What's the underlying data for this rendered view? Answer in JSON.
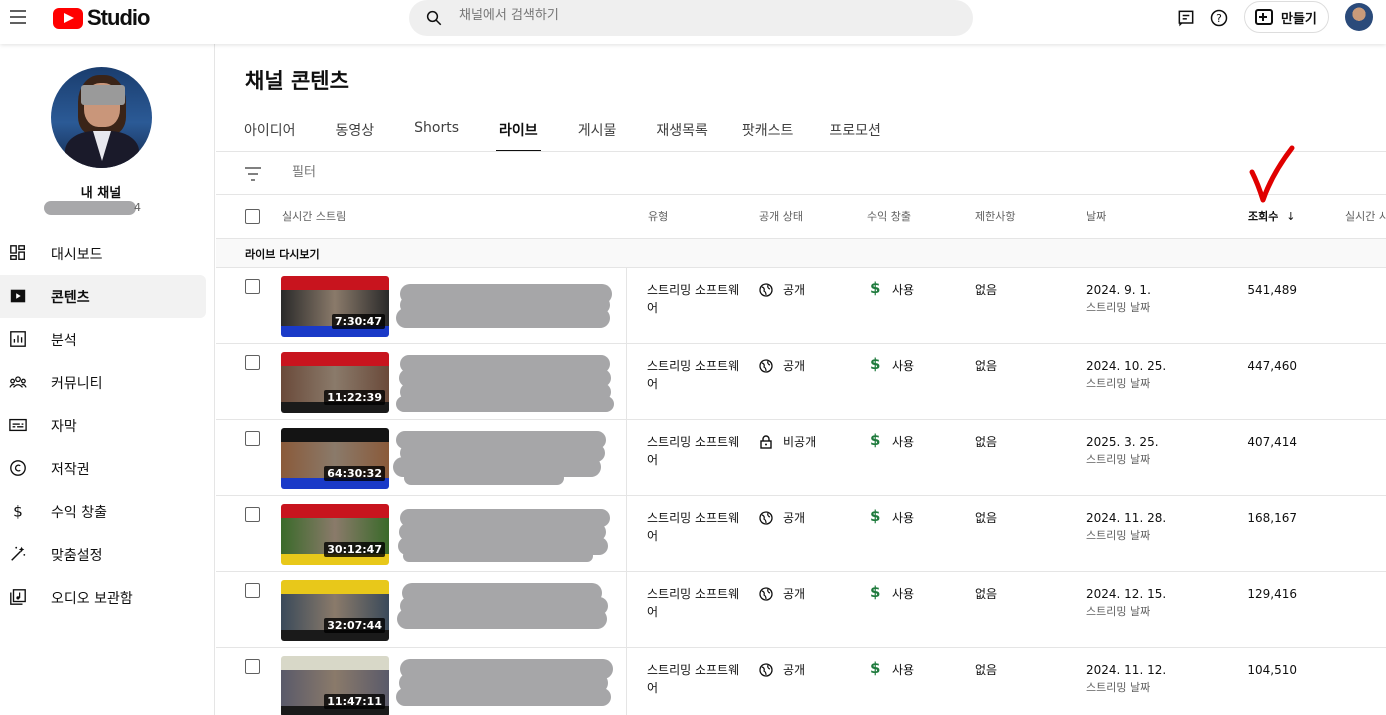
{
  "header": {
    "logo_text": "Studio",
    "search_placeholder": "채널에서 검색하기",
    "create_label": "만들기"
  },
  "sidebar": {
    "channel_label": "내 채널",
    "channel_sub_tail": "4",
    "items": [
      {
        "label": "대시보드",
        "icon": "dashboard-icon"
      },
      {
        "label": "콘텐츠",
        "icon": "content-icon",
        "active": true
      },
      {
        "label": "분석",
        "icon": "analytics-icon"
      },
      {
        "label": "커뮤니티",
        "icon": "community-icon"
      },
      {
        "label": "자막",
        "icon": "subtitles-icon"
      },
      {
        "label": "저작권",
        "icon": "copyright-icon"
      },
      {
        "label": "수익 창출",
        "icon": "dollar-icon"
      },
      {
        "label": "맞춤설정",
        "icon": "magic-wand-icon"
      },
      {
        "label": "오디오 보관함",
        "icon": "audio-library-icon"
      }
    ]
  },
  "main": {
    "title": "채널 콘텐츠",
    "tabs": [
      "아이디어",
      "동영상",
      "Shorts",
      "라이브",
      "게시물",
      "재생목록",
      "팟캐스트",
      "프로모션"
    ],
    "active_tab": "라이브",
    "filter_placeholder": "필터",
    "columns": {
      "stream": "실시간 스트림",
      "type": "유형",
      "visibility": "공개 상태",
      "monetization": "수익 창출",
      "restrictions": "제한사항",
      "date": "날짜",
      "views": "조회수",
      "live": "실시간 시"
    },
    "sort_arrow": "↓",
    "section_label": "라이브 다시보기",
    "rows": [
      {
        "duration": "7:30:47",
        "type_line1": "스트리밍 소프트웨",
        "type_line2": "어",
        "visibility": "공개",
        "monetization": "사용",
        "restrictions": "없음",
        "date": "2024. 9. 1.",
        "date_sub": "스트리밍 날짜",
        "views": "541,489",
        "thumb_colors": [
          "#c8141e",
          "#2a2a2a",
          "#1a3ac8"
        ]
      },
      {
        "duration": "11:22:39",
        "type_line1": "스트리밍 소프트웨",
        "type_line2": "어",
        "visibility": "공개",
        "monetization": "사용",
        "restrictions": "없음",
        "date": "2024. 10. 25.",
        "date_sub": "스트리밍 날짜",
        "views": "447,460",
        "thumb_colors": [
          "#c8141e",
          "#6a4a3a",
          "#1a1a1a"
        ]
      },
      {
        "duration": "64:30:32",
        "type_line1": "스트리밍 소프트웨",
        "type_line2": "어",
        "visibility": "비공개",
        "monetization": "사용",
        "restrictions": "없음",
        "date": "2025. 3. 25.",
        "date_sub": "스트리밍 날짜",
        "views": "407,414",
        "thumb_colors": [
          "#141414",
          "#8a5a3a",
          "#1a3ac8"
        ]
      },
      {
        "duration": "30:12:47",
        "type_line1": "스트리밍 소프트웨",
        "type_line2": "어",
        "visibility": "공개",
        "monetization": "사용",
        "restrictions": "없음",
        "date": "2024. 11. 28.",
        "date_sub": "스트리밍 날짜",
        "views": "168,167",
        "thumb_colors": [
          "#c8141e",
          "#3a6a2a",
          "#e8c81a"
        ]
      },
      {
        "duration": "32:07:44",
        "type_line1": "스트리밍 소프트웨",
        "type_line2": "어",
        "visibility": "공개",
        "monetization": "사용",
        "restrictions": "없음",
        "date": "2024. 12. 15.",
        "date_sub": "스트리밍 날짜",
        "views": "129,416",
        "thumb_colors": [
          "#e8c81a",
          "#3a4a5a",
          "#1a1a1a"
        ]
      },
      {
        "duration": "11:47:11",
        "type_line1": "스트리밍 소프트웨",
        "type_line2": "어",
        "visibility": "공개",
        "monetization": "사용",
        "restrictions": "없음",
        "date": "2024. 11. 12.",
        "date_sub": "스트리밍 날짜",
        "views": "104,510",
        "thumb_colors": [
          "#d8d8c8",
          "#5a5a6a",
          "#1a1a1a"
        ]
      }
    ]
  },
  "annotation": {
    "checkmark_color": "#e00000"
  }
}
